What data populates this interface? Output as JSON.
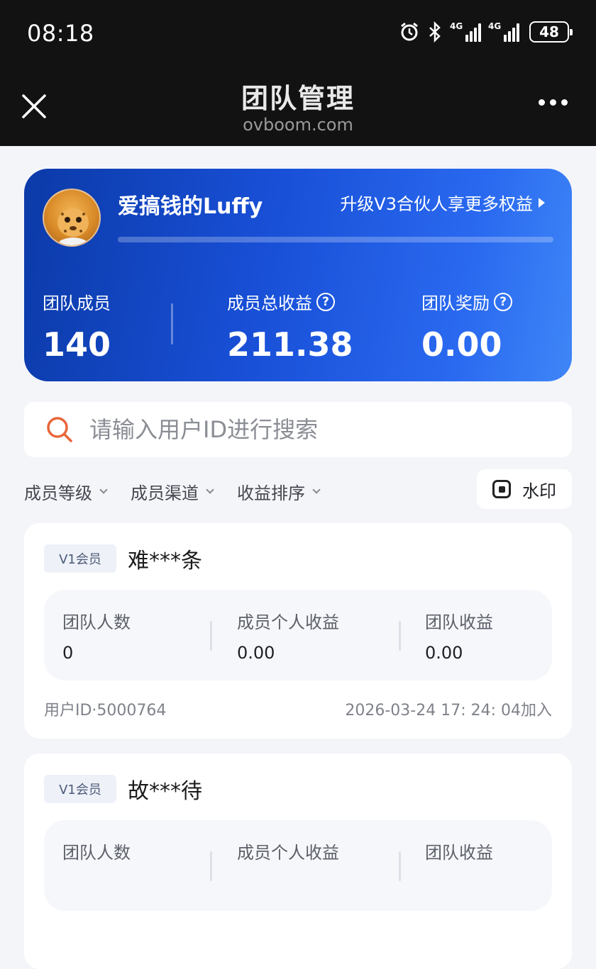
{
  "status_bar": {
    "time": "08:18",
    "network1": "4G",
    "network2": "4G",
    "battery": "48"
  },
  "header": {
    "title": "团队管理",
    "domain": "ovboom.com"
  },
  "hero": {
    "username": "爱搞钱的Luffy",
    "upgrade_text": "升级V3合伙人享更多权益",
    "progress": 0,
    "stats": [
      {
        "label": "团队成员",
        "value": "140",
        "help": false
      },
      {
        "label": "成员总收益",
        "value": "211.38",
        "help": true
      },
      {
        "label": "团队奖励",
        "value": "0.00",
        "help": true
      }
    ],
    "help_glyph": "?"
  },
  "search": {
    "placeholder": "请输入用户ID进行搜索",
    "value": ""
  },
  "filters": [
    {
      "label": "成员等级"
    },
    {
      "label": "成员渠道"
    },
    {
      "label": "收益排序"
    }
  ],
  "watermark_label": "水印",
  "members": [
    {
      "level": "V1会员",
      "name": "难***条",
      "stats": [
        {
          "label": "团队人数",
          "value": "0"
        },
        {
          "label": "成员个人收益",
          "value": "0.00"
        },
        {
          "label": "团队收益",
          "value": "0.00"
        }
      ],
      "uid_text": "用户ID·5000764",
      "joined": "2026-03-24 17: 24: 04加入"
    },
    {
      "level": "V1会员",
      "name": "故***待",
      "stats": [
        {
          "label": "团队人数",
          "value": ""
        },
        {
          "label": "成员个人收益",
          "value": ""
        },
        {
          "label": "团队收益",
          "value": ""
        }
      ],
      "uid_text": "",
      "joined": ""
    }
  ],
  "colors": {
    "accent": "#1950d8",
    "search_icon": "#e8663a",
    "topbar": "#121212",
    "page_bg": "#f4f5f9"
  }
}
